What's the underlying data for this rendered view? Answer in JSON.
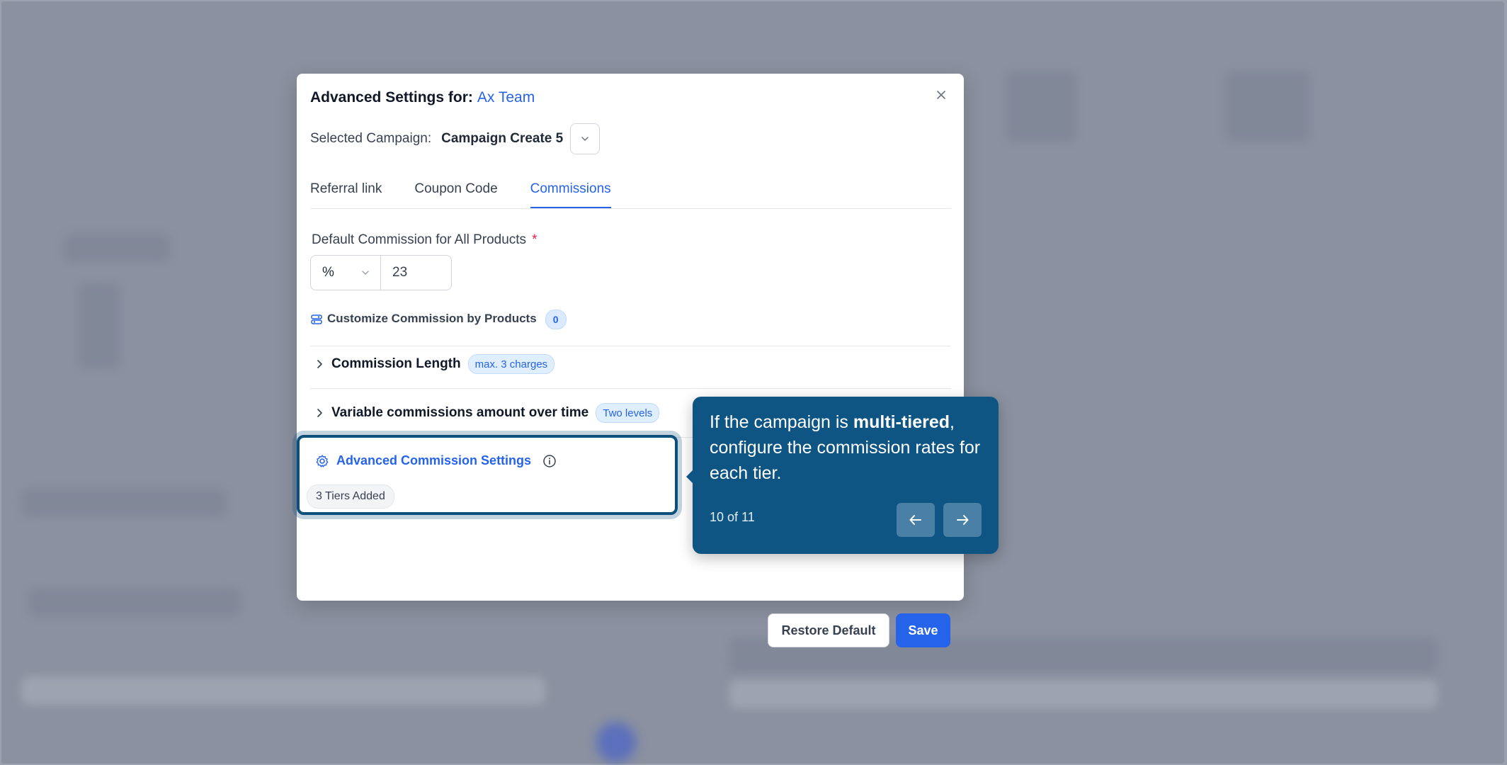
{
  "modal": {
    "title_prefix": "Advanced Settings for:",
    "team_name": "Ax Team",
    "close_icon": "close-icon",
    "campaign_label": "Selected Campaign:",
    "campaign_value": "Campaign Create 5",
    "tabs": [
      {
        "label": "Referral link",
        "active": false
      },
      {
        "label": "Coupon Code",
        "active": false
      },
      {
        "label": "Commissions",
        "active": true
      }
    ],
    "default_commission": {
      "label": "Default Commission for All Products",
      "required_mark": "*",
      "unit": "%",
      "value": "23"
    },
    "customize": {
      "label": "Customize Commission by Products",
      "count": "0"
    },
    "commission_length": {
      "label": "Commission Length",
      "badge": "max. 3 charges"
    },
    "variable_commissions": {
      "label": "Variable commissions amount over time",
      "badge": "Two levels"
    },
    "advanced": {
      "title": "Advanced Commission Settings",
      "chip": "3 Tiers Added"
    },
    "buttons": {
      "restore": "Restore Default",
      "save": "Save"
    }
  },
  "tooltip": {
    "text_before": "If the campaign is ",
    "text_bold": "multi-tiered",
    "text_after": ", configure the commission rates for each tier.",
    "step": "10 of 11"
  },
  "colors": {
    "accent": "#2563eb",
    "tooltip_bg": "#0e5584",
    "overlay": "#8b91a0"
  }
}
